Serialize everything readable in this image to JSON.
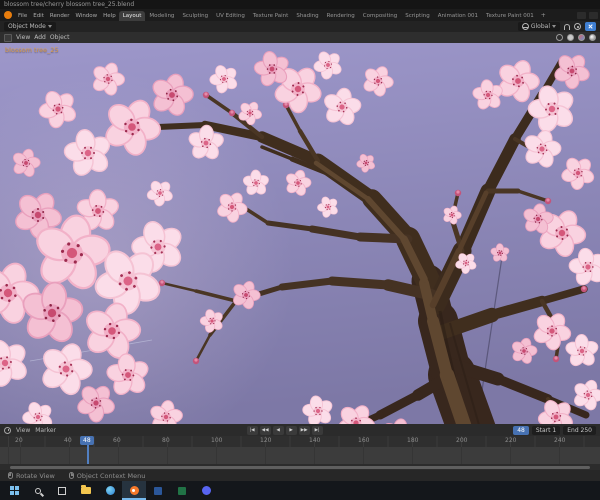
{
  "window": {
    "title": "blossom tree/cherry blossom tree_25.blend"
  },
  "topbar": {
    "menus": [
      "File",
      "Edit",
      "Render",
      "Window",
      "Help"
    ],
    "workspaces": [
      "Layout",
      "Modeling",
      "Sculpting",
      "UV Editing",
      "Texture Paint",
      "Shading",
      "Rendering",
      "Compositing",
      "Scripting",
      "Animation 001",
      "Texture Paint 001"
    ],
    "active_workspace": "Layout",
    "add_tab_label": "+"
  },
  "tool_header": {
    "mode": "Object Mode",
    "orientation": "Global",
    "menus": [
      "View",
      "Add",
      "Object"
    ],
    "icons": [
      "globe",
      "magnet",
      "proportional-editing",
      "shading-wireframe",
      "shading-solid",
      "shading-material",
      "shading-rendered"
    ]
  },
  "viewport": {
    "object_label": "blossom tree_25"
  },
  "timeline": {
    "menus": [
      "View",
      "Marker"
    ],
    "playback": [
      "|◀",
      "◀◀",
      "◀",
      "▶",
      "▶▶",
      "▶|"
    ],
    "current_frame": "48",
    "start_field": "Start 1",
    "end_field": "End 250",
    "ticks": [
      "20",
      "40",
      "60",
      "80",
      "100",
      "120",
      "140",
      "160",
      "180",
      "200",
      "220",
      "240"
    ]
  },
  "statusbar": {
    "hint_left": "Rotate View",
    "hint_right": "Object Context Menu"
  },
  "taskbar": {
    "apps": [
      "start",
      "search",
      "task-view",
      "file-explorer",
      "browser",
      "blender",
      "word",
      "spreadsheet",
      "chat"
    ],
    "active_app": "blender"
  },
  "colors": {
    "accent_blue": "#4772b3",
    "blender_orange": "#e87d0d",
    "sky": "#8b86b6",
    "blossom_pink": "#f6c8da",
    "branch_brown": "#43301f",
    "playhead_blue": "#5280c2"
  }
}
